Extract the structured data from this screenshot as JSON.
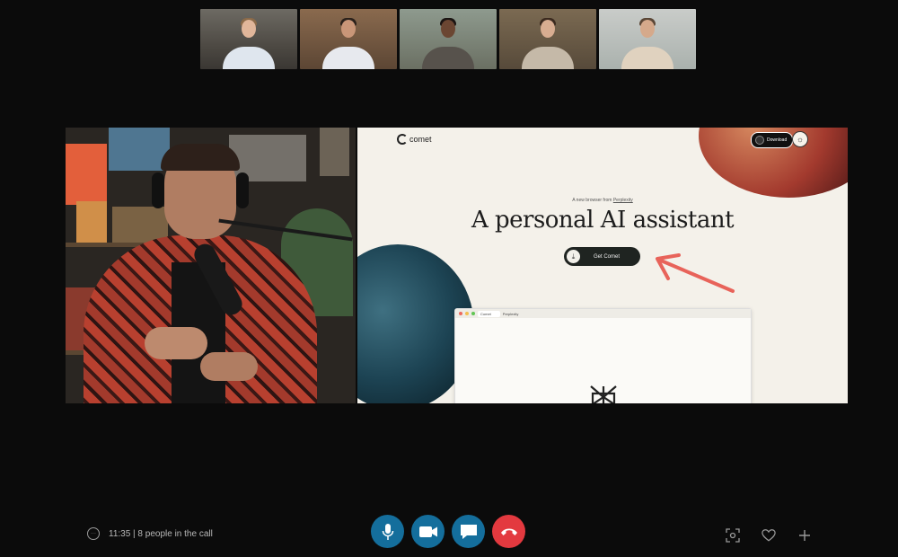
{
  "shared_screen": {
    "logo_text": "comet",
    "download_label": "Download",
    "tagline_prefix": "A new browser from ",
    "tagline_link": "Perplexity",
    "hero_text": "A personal AI assistant",
    "cta_label": "Get Comet",
    "mini_browser_tabs": [
      "Comet",
      "Perplexity"
    ]
  },
  "call": {
    "status_text": "11:35 | 8 people in the call"
  },
  "icons": [
    "chat-icon",
    "microphone-icon",
    "video-camera-icon",
    "message-icon",
    "end-call-icon",
    "screenshot-icon",
    "heart-icon",
    "plus-icon"
  ],
  "colors": {
    "control_blue": "#146e9c",
    "end_call_red": "#e3393f",
    "annotation_arrow": "#e8635a"
  }
}
